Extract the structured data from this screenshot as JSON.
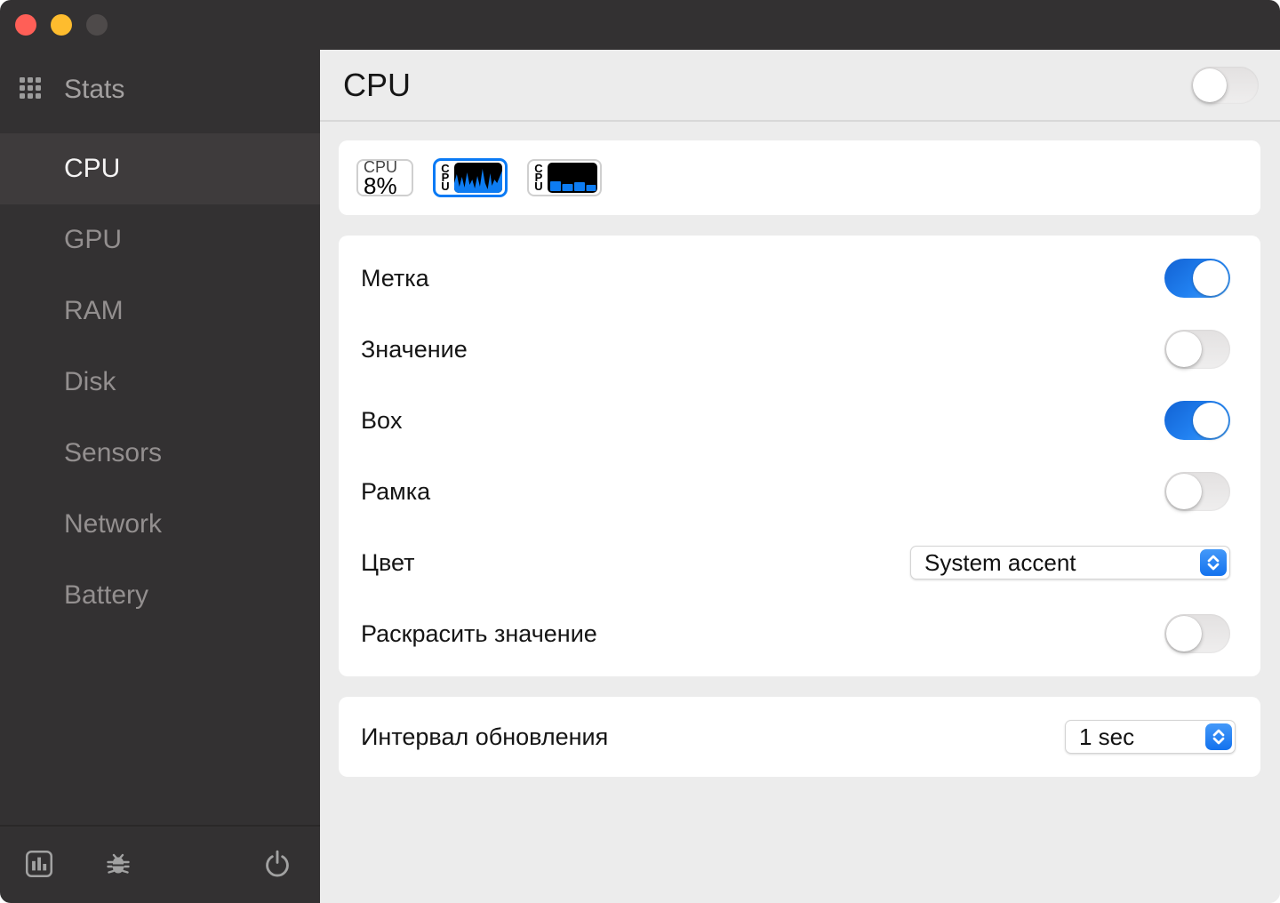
{
  "window": {
    "traffic_lights": [
      {
        "name": "close",
        "color": "#ff5f57"
      },
      {
        "name": "minimize",
        "color": "#febc2e"
      },
      {
        "name": "zoom",
        "color": "#4e4a4a"
      }
    ]
  },
  "sidebar": {
    "app_title": "Stats",
    "items": [
      {
        "label": "CPU",
        "selected": true
      },
      {
        "label": "GPU",
        "selected": false
      },
      {
        "label": "RAM",
        "selected": false
      },
      {
        "label": "Disk",
        "selected": false
      },
      {
        "label": "Sensors",
        "selected": false
      },
      {
        "label": "Network",
        "selected": false
      },
      {
        "label": "Battery",
        "selected": false
      }
    ],
    "footer_icons": [
      "bar-chart",
      "bug",
      "power"
    ]
  },
  "main": {
    "title": "CPU",
    "module_toggle_on": false,
    "widgets": [
      {
        "type": "mini",
        "label": "CPU",
        "value": "8%",
        "selected": false
      },
      {
        "type": "line-chart",
        "label": "CPU",
        "selected": true
      },
      {
        "type": "bar-chart",
        "label": "CPU",
        "selected": false
      }
    ],
    "settings": [
      {
        "label": "Метка",
        "type": "toggle",
        "on": true
      },
      {
        "label": "Значение",
        "type": "toggle",
        "on": false
      },
      {
        "label": "Box",
        "type": "toggle",
        "on": true
      },
      {
        "label": "Рамка",
        "type": "toggle",
        "on": false
      },
      {
        "label": "Цвет",
        "type": "select",
        "value": "System accent"
      },
      {
        "label": "Раскрасить значение",
        "type": "toggle",
        "on": false
      }
    ],
    "interval": {
      "label": "Интервал обновления",
      "value": "1 sec"
    }
  },
  "colors": {
    "accent_blue": "#1a7cf0",
    "widget_chart_blue": "#0d7cf2",
    "sidebar_bg": "#333132",
    "main_bg": "#ececec",
    "card_bg": "#ffffff"
  }
}
